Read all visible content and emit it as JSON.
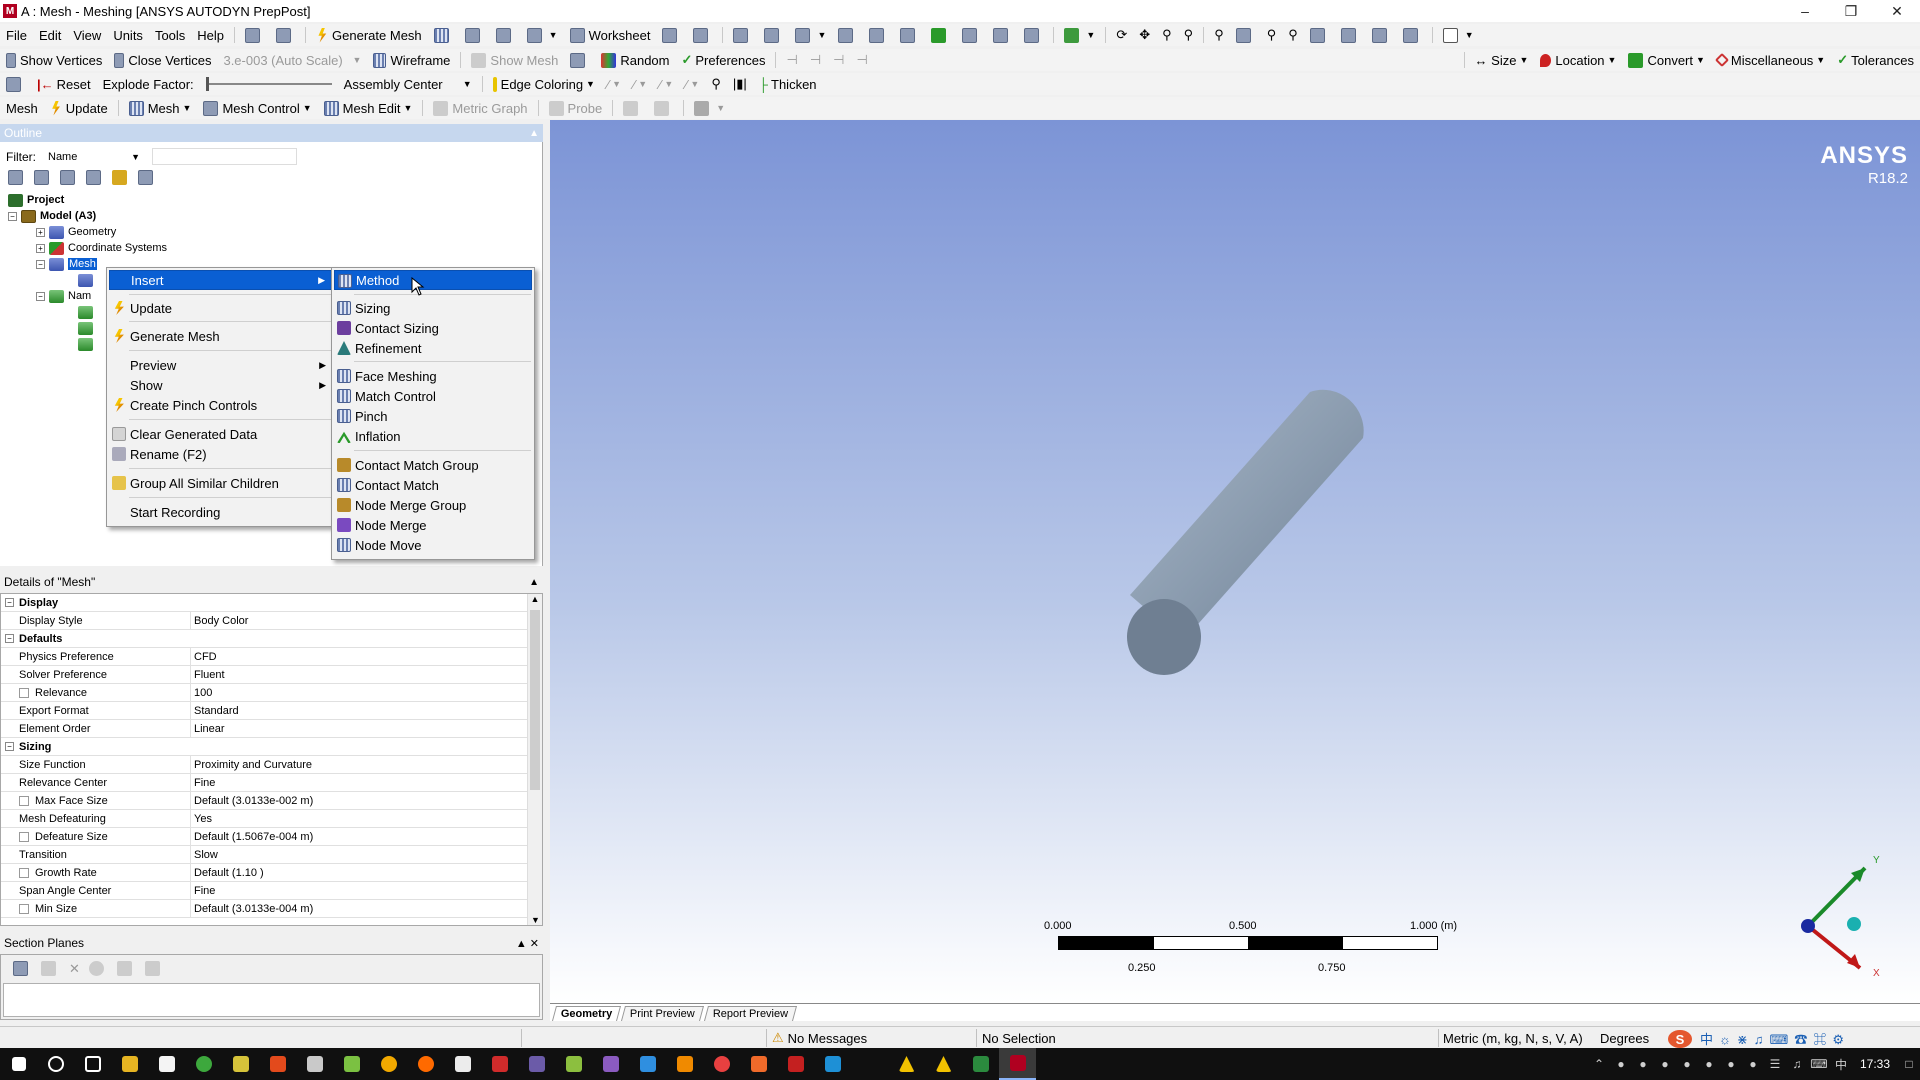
{
  "window": {
    "title": "A : Mesh - Meshing [ANSYS AUTODYN PrepPost]"
  },
  "menubar": [
    "File",
    "Edit",
    "View",
    "Units",
    "Tools",
    "Help"
  ],
  "toolbar1": {
    "generate_mesh": "Generate Mesh",
    "worksheet": "Worksheet"
  },
  "toolbar2": {
    "show_vertices": "Show Vertices",
    "close_vertices": "Close Vertices",
    "scale_value": "3.e-003 (Auto Scale)",
    "wireframe": "Wireframe",
    "show_mesh": "Show Mesh",
    "random": "Random",
    "preferences": "Preferences",
    "size": "Size",
    "location": "Location",
    "convert": "Convert",
    "misc": "Miscellaneous",
    "tolerances": "Tolerances"
  },
  "toolbar3": {
    "reset": "Reset",
    "explode_factor": "Explode Factor:",
    "assembly_center": "Assembly Center",
    "edge_coloring": "Edge Coloring",
    "thicken": "Thicken"
  },
  "toolbar4": {
    "mesh_label": "Mesh",
    "update": "Update",
    "mesh": "Mesh",
    "mesh_control": "Mesh Control",
    "mesh_edit": "Mesh Edit",
    "metric_graph": "Metric Graph",
    "probe": "Probe"
  },
  "outline": {
    "title": "Outline",
    "filter_label": "Filter:",
    "filter_value": "Name",
    "tree": {
      "project": "Project",
      "model": "Model (A3)",
      "geometry": "Geometry",
      "coordinate_systems": "Coordinate Systems",
      "mesh": "Mesh",
      "named": "Nam"
    }
  },
  "context_menu": {
    "items": [
      "Insert",
      "Update",
      "Generate Mesh",
      "Preview",
      "Show",
      "Create Pinch Controls",
      "Clear Generated Data",
      "Rename (F2)",
      "Group All Similar Children",
      "Start Recording"
    ]
  },
  "submenu": {
    "items": [
      "Method",
      "Sizing",
      "Contact Sizing",
      "Refinement",
      "Face Meshing",
      "Match Control",
      "Pinch",
      "Inflation",
      "Contact Match Group",
      "Contact Match",
      "Node Merge Group",
      "Node Merge",
      "Node Move"
    ]
  },
  "details": {
    "title": "Details of \"Mesh\"",
    "rows": [
      {
        "type": "cat",
        "k": "Display"
      },
      {
        "type": "row",
        "k": "Display Style",
        "v": "Body Color"
      },
      {
        "type": "cat",
        "k": "Defaults"
      },
      {
        "type": "row",
        "k": "Physics Preference",
        "v": "CFD"
      },
      {
        "type": "row",
        "k": "Solver Preference",
        "v": "Fluent"
      },
      {
        "type": "cbx",
        "k": "Relevance",
        "v": "100"
      },
      {
        "type": "row",
        "k": "Export Format",
        "v": "Standard"
      },
      {
        "type": "row",
        "k": "Element Order",
        "v": "Linear"
      },
      {
        "type": "cat",
        "k": "Sizing"
      },
      {
        "type": "row",
        "k": "Size Function",
        "v": "Proximity and Curvature"
      },
      {
        "type": "row",
        "k": "Relevance Center",
        "v": "Fine"
      },
      {
        "type": "cbx",
        "k": "Max Face Size",
        "v": "Default (3.0133e-002 m)"
      },
      {
        "type": "row",
        "k": "Mesh Defeaturing",
        "v": "Yes"
      },
      {
        "type": "cbx",
        "k": "Defeature Size",
        "v": "Default (1.5067e-004 m)"
      },
      {
        "type": "row",
        "k": "Transition",
        "v": "Slow"
      },
      {
        "type": "cbx",
        "k": "Growth Rate",
        "v": "Default (1.10 )"
      },
      {
        "type": "row",
        "k": "Span Angle Center",
        "v": "Fine"
      },
      {
        "type": "cbx",
        "k": "Min Size",
        "v": "Default (3.0133e-004 m)"
      }
    ]
  },
  "section_planes": {
    "title": "Section Planes"
  },
  "viewport": {
    "logo": "ANSYS",
    "version": "R18.2",
    "scale_top": [
      "0.000",
      "0.500",
      "1.000 (m)"
    ],
    "scale_bottom": [
      "0.250",
      "0.750"
    ],
    "axis_y": "Y",
    "axis_x": "X",
    "tabs": [
      "Geometry",
      "Print Preview",
      "Report Preview"
    ]
  },
  "statusbar": {
    "messages": "No Messages",
    "selection": "No Selection",
    "units": "Metric (m, kg, N, s, V, A)",
    "angle": "Degrees"
  },
  "taskbar": {
    "time": "17:33"
  },
  "colors": {
    "highlight": "#0a5fd3",
    "viewport_top": "#7c94d6",
    "cylinder": "#7d8fa3"
  }
}
